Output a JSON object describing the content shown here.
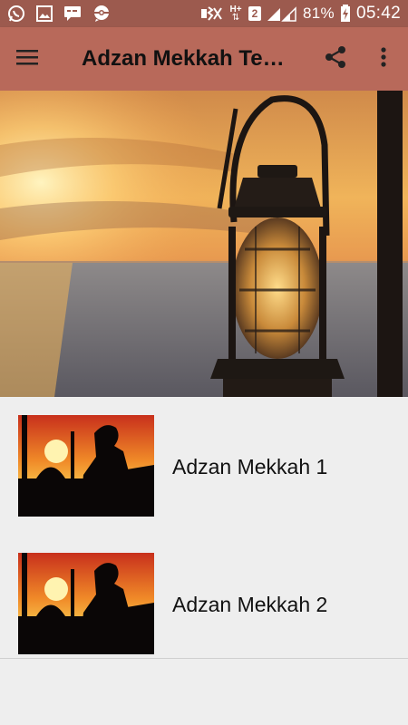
{
  "status_bar": {
    "icons_left": [
      "whatsapp-icon",
      "gallery-icon",
      "chat-icon",
      "pokemon-icon"
    ],
    "icons_right": [
      "mute-icon",
      "data-arrows-icon",
      "sim2-icon",
      "signal-icon",
      "battery-charging-icon"
    ],
    "network_label": "H+",
    "sim_label": "2",
    "battery": "81%",
    "time": "05:42"
  },
  "app_bar": {
    "title": "Adzan Mekkah Terl...",
    "menu_icon": "hamburger-menu-icon",
    "share_icon": "share-icon",
    "more_icon": "more-vertical-icon"
  },
  "banner": {
    "image": "lantern-at-sunset-photo"
  },
  "items": [
    {
      "label": "Adzan Mekkah 1",
      "thumbnail": "muezzin-silhouette-sunset"
    },
    {
      "label": "Adzan Mekkah 2",
      "thumbnail": "muezzin-silhouette-sunset"
    }
  ],
  "colors": {
    "status_bar": "#9c5a4e",
    "app_bar": "#b8695a",
    "background": "#eeeeee"
  }
}
